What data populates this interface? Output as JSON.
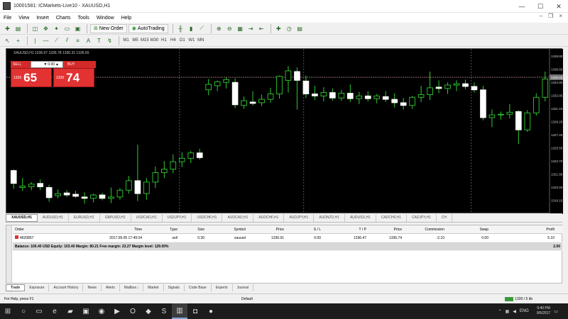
{
  "window": {
    "title": "10001581: ICMarkets-Live10 - XAUUSD,H1",
    "minimize": "—",
    "maximize": "☐",
    "close": "✕"
  },
  "menu": [
    "File",
    "View",
    "Insert",
    "Charts",
    "Tools",
    "Window",
    "Help"
  ],
  "toolbar": {
    "new_order": "New Order",
    "autotrading": "AutoTrading",
    "timeframes": [
      "M1",
      "M5",
      "M15",
      "M30",
      "H1",
      "H4",
      "D1",
      "W1",
      "MN"
    ]
  },
  "chart": {
    "symbol_info": "XAUUSD,H1  1336.67 1336.78 1336.31 1336.65",
    "one_click": {
      "sell_label": "SELL",
      "buy_label": "BUY",
      "lot": "0.00",
      "sell_price_small": "1336",
      "sell_price_big": "65",
      "buy_price_small": "1336",
      "buy_price_big": "74"
    },
    "price_axis": [
      "1338.80",
      "1336.65",
      "1334.80",
      "1332.95",
      "1331.10",
      "1329.25",
      "1327.40",
      "1325.55",
      "1323.70",
      "1321.85",
      "1320.00",
      "1318.15"
    ]
  },
  "chart_data": {
    "type": "candlestick",
    "title": "",
    "ylim": [
      1317,
      1340
    ],
    "current_price": 1336.65,
    "candles": [
      {
        "o": 1322.9,
        "h": 1323.1,
        "l": 1320.2,
        "c": 1321.0
      },
      {
        "o": 1320.4,
        "h": 1321.8,
        "l": 1319.9,
        "c": 1320.6
      },
      {
        "o": 1320.5,
        "h": 1321.2,
        "l": 1320.0,
        "c": 1320.9
      },
      {
        "o": 1321.0,
        "h": 1321.6,
        "l": 1320.0,
        "c": 1320.5
      },
      {
        "o": 1320.4,
        "h": 1320.8,
        "l": 1318.3,
        "c": 1318.9
      },
      {
        "o": 1319.2,
        "h": 1320.1,
        "l": 1318.8,
        "c": 1319.5
      },
      {
        "o": 1319.6,
        "h": 1320.0,
        "l": 1319.0,
        "c": 1319.3
      },
      {
        "o": 1319.4,
        "h": 1319.9,
        "l": 1318.9,
        "c": 1319.1
      },
      {
        "o": 1319.0,
        "h": 1319.7,
        "l": 1318.0,
        "c": 1318.8
      },
      {
        "o": 1318.8,
        "h": 1319.5,
        "l": 1318.2,
        "c": 1319.3
      },
      {
        "o": 1319.3,
        "h": 1319.6,
        "l": 1318.5,
        "c": 1318.8
      },
      {
        "o": 1318.8,
        "h": 1320.4,
        "l": 1318.1,
        "c": 1319.0
      },
      {
        "o": 1319.0,
        "h": 1320.3,
        "l": 1318.6,
        "c": 1320.0
      },
      {
        "o": 1320.0,
        "h": 1322.1,
        "l": 1319.5,
        "c": 1321.4
      },
      {
        "o": 1321.4,
        "h": 1326.7,
        "l": 1318.4,
        "c": 1319.5
      },
      {
        "o": 1319.5,
        "h": 1321.8,
        "l": 1318.6,
        "c": 1321.2
      },
      {
        "o": 1321.2,
        "h": 1323.5,
        "l": 1320.3,
        "c": 1322.6
      },
      {
        "o": 1322.6,
        "h": 1324.3,
        "l": 1321.8,
        "c": 1323.1
      },
      {
        "o": 1323.1,
        "h": 1325.3,
        "l": 1322.5,
        "c": 1324.2
      },
      {
        "o": 1324.2,
        "h": 1325.6,
        "l": 1323.4,
        "c": 1324.7
      },
      {
        "o": 1324.7,
        "h": 1325.8,
        "l": 1324.0,
        "c": 1325.5
      },
      {
        "o": 1325.5,
        "h": 1326.1,
        "l": 1324.5,
        "c": 1324.8
      },
      {
        "o": 1334.8,
        "h": 1336.4,
        "l": 1334.0,
        "c": 1335.6
      },
      {
        "o": 1335.4,
        "h": 1336.2,
        "l": 1334.6,
        "c": 1336.0
      },
      {
        "o": 1335.9,
        "h": 1336.7,
        "l": 1335.0,
        "c": 1336.3
      },
      {
        "o": 1335.9,
        "h": 1336.5,
        "l": 1332.1,
        "c": 1332.6
      },
      {
        "o": 1332.5,
        "h": 1333.8,
        "l": 1332.0,
        "c": 1333.2
      },
      {
        "o": 1333.0,
        "h": 1334.6,
        "l": 1332.5,
        "c": 1332.8
      },
      {
        "o": 1332.9,
        "h": 1334.1,
        "l": 1332.4,
        "c": 1333.4
      },
      {
        "o": 1333.4,
        "h": 1335.1,
        "l": 1332.9,
        "c": 1334.2
      },
      {
        "o": 1334.2,
        "h": 1336.9,
        "l": 1333.5,
        "c": 1336.8
      },
      {
        "o": 1336.2,
        "h": 1338.3,
        "l": 1334.4,
        "c": 1337.6
      },
      {
        "o": 1337.5,
        "h": 1338.1,
        "l": 1331.9,
        "c": 1336.2
      },
      {
        "o": 1336.1,
        "h": 1336.9,
        "l": 1333.6,
        "c": 1334.2
      },
      {
        "o": 1334.2,
        "h": 1335.4,
        "l": 1333.3,
        "c": 1333.9
      },
      {
        "o": 1333.9,
        "h": 1335.2,
        "l": 1333.1,
        "c": 1334.4
      },
      {
        "o": 1334.4,
        "h": 1335.0,
        "l": 1333.2,
        "c": 1333.6
      },
      {
        "o": 1333.6,
        "h": 1334.8,
        "l": 1333.2,
        "c": 1334.3
      },
      {
        "o": 1334.3,
        "h": 1335.6,
        "l": 1333.0,
        "c": 1333.5
      },
      {
        "o": 1333.5,
        "h": 1334.5,
        "l": 1332.7,
        "c": 1333.9
      },
      {
        "o": 1333.9,
        "h": 1334.6,
        "l": 1333.1,
        "c": 1333.5
      },
      {
        "o": 1333.5,
        "h": 1334.2,
        "l": 1332.8,
        "c": 1333.9
      },
      {
        "o": 1333.8,
        "h": 1334.6,
        "l": 1333.0,
        "c": 1333.4
      },
      {
        "o": 1333.4,
        "h": 1334.3,
        "l": 1332.2,
        "c": 1332.9
      },
      {
        "o": 1332.9,
        "h": 1333.6,
        "l": 1331.9,
        "c": 1332.5
      },
      {
        "o": 1332.5,
        "h": 1333.9,
        "l": 1332.0,
        "c": 1333.7
      },
      {
        "o": 1333.7,
        "h": 1335.4,
        "l": 1333.0,
        "c": 1334.1
      },
      {
        "o": 1334.1,
        "h": 1337.5,
        "l": 1333.3,
        "c": 1335.1
      },
      {
        "o": 1335.2,
        "h": 1336.2,
        "l": 1334.3,
        "c": 1335.0
      },
      {
        "o": 1335.0,
        "h": 1335.9,
        "l": 1334.2,
        "c": 1335.5
      },
      {
        "o": 1335.5,
        "h": 1336.2,
        "l": 1334.6,
        "c": 1335.7
      },
      {
        "o": 1335.7,
        "h": 1336.3,
        "l": 1334.9,
        "c": 1335.3
      },
      {
        "o": 1335.3,
        "h": 1335.9,
        "l": 1334.4,
        "c": 1334.8
      },
      {
        "o": 1334.8,
        "h": 1335.4,
        "l": 1330.3,
        "c": 1330.7
      },
      {
        "o": 1330.7,
        "h": 1331.9,
        "l": 1329.3,
        "c": 1331.1
      },
      {
        "o": 1331.1,
        "h": 1331.6,
        "l": 1330.4,
        "c": 1331.2
      },
      {
        "o": 1331.2,
        "h": 1332.7,
        "l": 1330.6,
        "c": 1331.5
      },
      {
        "o": 1331.6,
        "h": 1331.8,
        "l": 1326.8,
        "c": 1328.9
      },
      {
        "o": 1328.9,
        "h": 1331.8,
        "l": 1328.6,
        "c": 1331.4
      },
      {
        "o": 1331.4,
        "h": 1334.3,
        "l": 1331.0,
        "c": 1333.7
      },
      {
        "o": 1333.7,
        "h": 1337.5,
        "l": 1333.1,
        "c": 1336.4
      }
    ]
  },
  "symbol_tabs": [
    "XAUUSD,H1",
    "AUDUSD,H1",
    "EURUSD,H1",
    "GBPUSD,H1",
    "USDCAD,H1",
    "USDJPY,H1",
    "USDCHF,H1",
    "AUDCAD,H1",
    "AUDCHF,H1",
    "AUDJPY,H1",
    "AUDNZD,H1",
    "AUDUSD,H1",
    "CADCHF,H1",
    "CADJPY,H1",
    "CH"
  ],
  "terminal": {
    "headers": [
      "Order",
      "Time",
      "Type",
      "Size",
      "Symbol",
      "Price",
      "S / L",
      "T / P",
      "Price",
      "Commission",
      "Swap",
      "Profit"
    ],
    "row": [
      "4620857",
      "2017.09.05 17:49:34",
      "sell",
      "0.30",
      "xauusd",
      "1336.91",
      "0.00",
      "1336.47",
      "1336.74",
      "-2.10",
      "0.00",
      "5.10"
    ],
    "balance": "Balance: 100.40 USD  Equity: 103.40  Margin: 80.21  Free margin: 23.27  Margin level: 129.00%",
    "balance_profit": "2.00"
  },
  "term_tabs": [
    "Trade",
    "Exposure",
    "Account History",
    "News",
    "Alerts",
    "Mailbox",
    "Market",
    "Signals",
    "Code Base",
    "Experts",
    "Journal"
  ],
  "mailbox_badge": "1",
  "statusbar": {
    "help": "For Help, press F1",
    "profile": "Default",
    "connection": "1330 / 5 kb"
  },
  "taskbar": {
    "lang": "ENG",
    "time": "9:40 PM",
    "date": "9/5/2017"
  }
}
